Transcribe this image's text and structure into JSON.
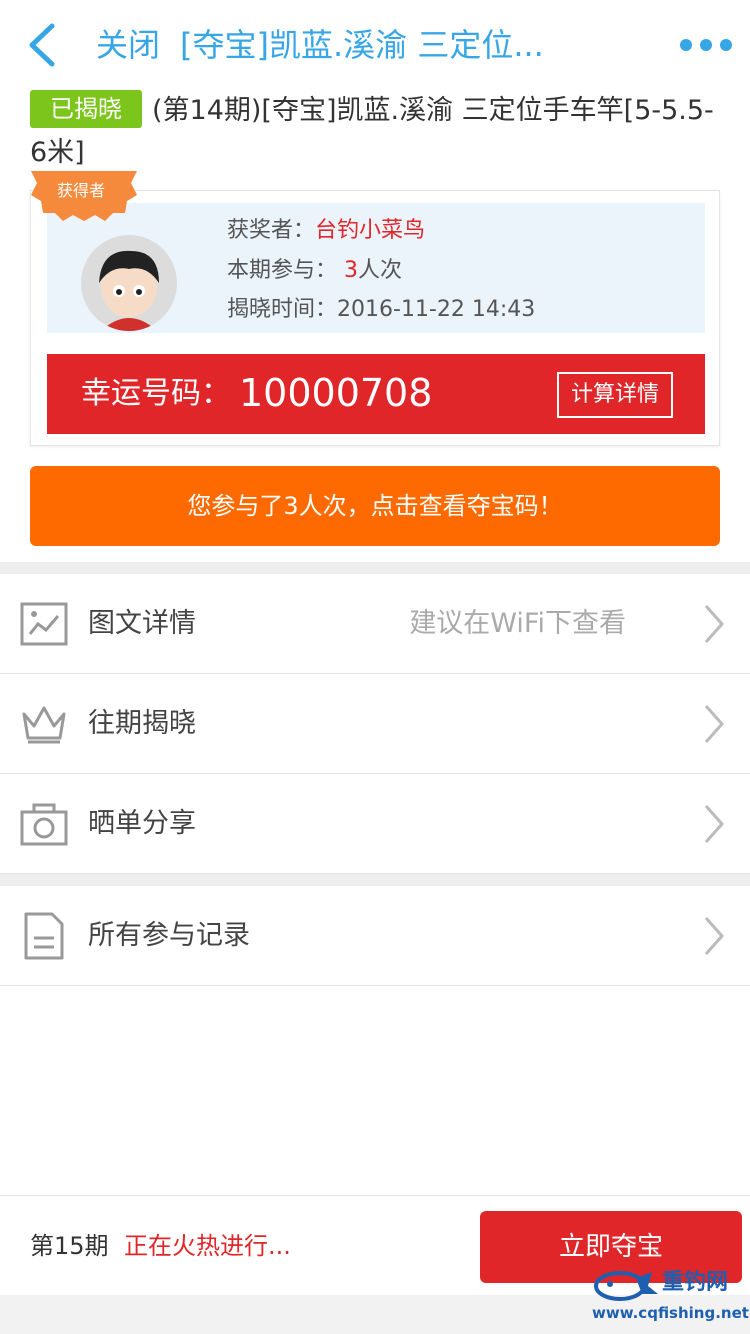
{
  "header": {
    "close_label": "关闭",
    "title": "[夺宝]凯蓝.溪渝 三定位..."
  },
  "product": {
    "badge": "已揭晓",
    "name": "(第14期)[夺宝]凯蓝.溪渝 三定位手车竿[5-5.5-6米]"
  },
  "winner": {
    "ribbon_label": "获得者",
    "winner_label": "获奖者：",
    "winner_name": "台钓小菜鸟",
    "participation_label": "本期参与：",
    "participation_count": "3",
    "participation_unit": "人次",
    "reveal_label": "揭晓时间：",
    "reveal_time": "2016-11-22 14:43",
    "lucky_label": "幸运号码：",
    "lucky_number": "10000708",
    "calc_button": "计算详情"
  },
  "my_participation": {
    "label": "您参与了3人次，点击查看夺宝码！"
  },
  "menu": {
    "items": [
      {
        "label": "图文详情",
        "hint": "建议在WiFi下查看"
      },
      {
        "label": "往期揭晓"
      },
      {
        "label": "晒单分享"
      },
      {
        "label": "所有参与记录"
      }
    ]
  },
  "bottom": {
    "period": "第15期",
    "status": "正在火热进行...",
    "buy_button": "立即夺宝"
  },
  "watermark": {
    "name": "重钓网",
    "url": "www.cqfishing.net"
  },
  "colors": {
    "accent_blue": "#37a6e6",
    "red": "#e1262a",
    "orange": "#ff6a00",
    "green": "#7cc51c"
  }
}
